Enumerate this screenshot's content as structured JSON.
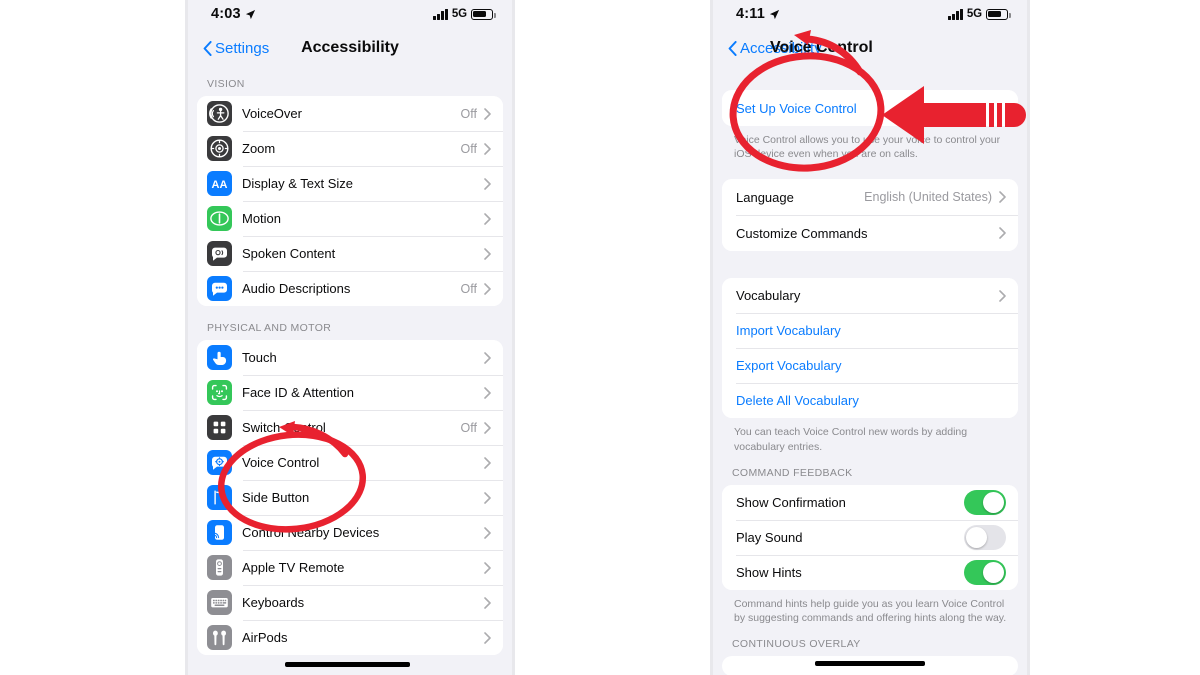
{
  "accent": {
    "ios_blue": "#0a7cff",
    "green_on": "#34c759",
    "annotation_red": "#e8222f",
    "bg": "#f2f2f7"
  },
  "left_phone": {
    "status": {
      "time": "4:03",
      "network": "5G",
      "location_icon": "location-arrow-icon",
      "signal_icon": "signal-bars-icon",
      "battery_icon": "battery-icon"
    },
    "nav": {
      "back_label": "Settings",
      "title": "Accessibility",
      "back_icon": "chevron-left-icon"
    },
    "sections": [
      {
        "header": "VISION",
        "rows": [
          {
            "label": "VoiceOver",
            "value": "Off",
            "icon": "voiceover-icon",
            "icon_bg": "#3a3a3c",
            "chevron": true
          },
          {
            "label": "Zoom",
            "value": "Off",
            "icon": "zoom-icon",
            "icon_bg": "#3a3a3c",
            "chevron": true
          },
          {
            "label": "Display & Text Size",
            "value": "",
            "icon": "display-text-size-icon",
            "icon_bg": "#0a7cff",
            "chevron": true
          },
          {
            "label": "Motion",
            "value": "",
            "icon": "motion-icon",
            "icon_bg": "#34c759",
            "chevron": true
          },
          {
            "label": "Spoken Content",
            "value": "",
            "icon": "spoken-content-icon",
            "icon_bg": "#3a3a3c",
            "chevron": true
          },
          {
            "label": "Audio Descriptions",
            "value": "Off",
            "icon": "audio-descriptions-icon",
            "icon_bg": "#0a7cff",
            "chevron": true
          }
        ]
      },
      {
        "header": "PHYSICAL AND MOTOR",
        "rows": [
          {
            "label": "Touch",
            "value": "",
            "icon": "touch-icon",
            "icon_bg": "#0a7cff",
            "chevron": true
          },
          {
            "label": "Face ID & Attention",
            "value": "",
            "icon": "face-id-icon",
            "icon_bg": "#34c759",
            "chevron": true
          },
          {
            "label": "Switch Control",
            "value": "Off",
            "icon": "switch-control-icon",
            "icon_bg": "#3a3a3c",
            "chevron": true
          },
          {
            "label": "Voice Control",
            "value": "",
            "icon": "voice-control-icon",
            "icon_bg": "#0a7cff",
            "chevron": true
          },
          {
            "label": "Side Button",
            "value": "",
            "icon": "side-button-icon",
            "icon_bg": "#0a7cff",
            "chevron": true
          },
          {
            "label": "Control Nearby Devices",
            "value": "",
            "icon": "nearby-devices-icon",
            "icon_bg": "#0a7cff",
            "chevron": true
          },
          {
            "label": "Apple TV Remote",
            "value": "",
            "icon": "apple-tv-remote-icon",
            "icon_bg": "#8e8e93",
            "chevron": true
          },
          {
            "label": "Keyboards",
            "value": "",
            "icon": "keyboards-icon",
            "icon_bg": "#8e8e93",
            "chevron": true
          },
          {
            "label": "AirPods",
            "value": "",
            "icon": "airpods-icon",
            "icon_bg": "#8e8e93",
            "chevron": true
          }
        ]
      }
    ],
    "annotations": {
      "circle": {
        "name": "red-circle-highlight",
        "target": "Voice Control"
      },
      "arrow": {
        "name": "red-arrow-pointer",
        "target": "Voice Control"
      }
    }
  },
  "right_phone": {
    "status": {
      "time": "4:11",
      "network": "5G",
      "location_icon": "location-arrow-icon",
      "signal_icon": "signal-bars-icon",
      "battery_icon": "battery-icon"
    },
    "nav": {
      "back_label": "Accessibility",
      "title": "Voice Control",
      "back_icon": "chevron-left-icon"
    },
    "setup": {
      "action_label": "Set Up Voice Control",
      "footnote": "Voice Control allows you to use your voice to control your iOS device even when you are on calls."
    },
    "settings_group": [
      {
        "label": "Language",
        "value": "English (United States)",
        "chevron": true
      },
      {
        "label": "Customize Commands",
        "value": "",
        "chevron": true
      }
    ],
    "vocabulary_group": [
      {
        "label": "Vocabulary",
        "value": "",
        "chevron": true,
        "link": false
      },
      {
        "label": "Import Vocabulary",
        "value": "",
        "chevron": false,
        "link": true
      },
      {
        "label": "Export Vocabulary",
        "value": "",
        "chevron": false,
        "link": true
      },
      {
        "label": "Delete All Vocabulary",
        "value": "",
        "chevron": false,
        "link": true
      }
    ],
    "vocabulary_footnote": "You can teach Voice Control new words by adding vocabulary entries.",
    "feedback_header": "COMMAND FEEDBACK",
    "feedback_rows": [
      {
        "label": "Show Confirmation",
        "toggle": "on"
      },
      {
        "label": "Play Sound",
        "toggle": "off"
      },
      {
        "label": "Show Hints",
        "toggle": "on"
      }
    ],
    "feedback_footnote": "Command hints help guide you as you learn Voice Control by suggesting commands and offering hints along the way.",
    "overlay_header": "CONTINUOUS OVERLAY",
    "annotations": {
      "circle": {
        "name": "red-circle-highlight",
        "target": "Set Up Voice Control"
      },
      "arrow": {
        "name": "red-arrow-pointer",
        "target": "Set Up Voice Control"
      }
    }
  }
}
